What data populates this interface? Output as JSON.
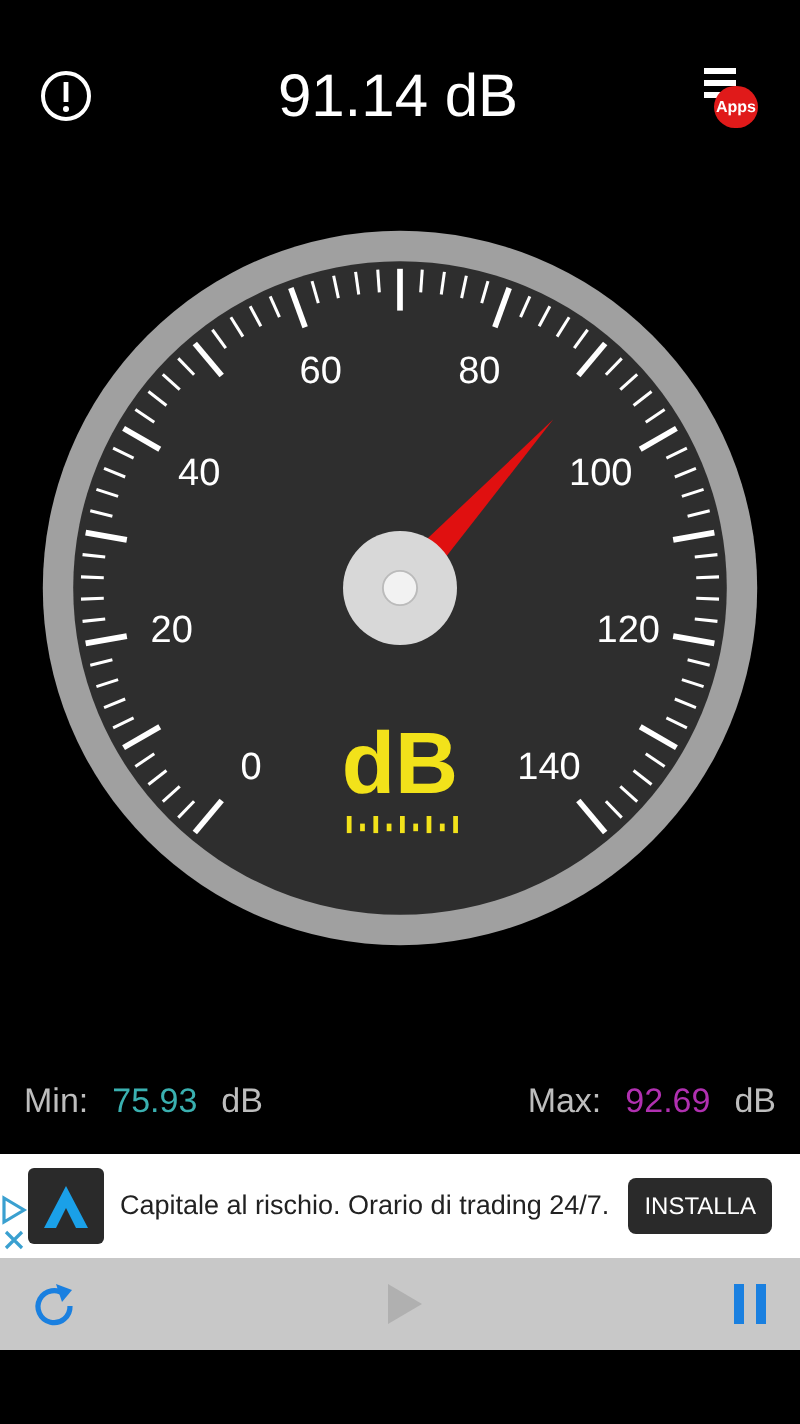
{
  "header": {
    "reading": "91.14 dB",
    "menu_badge": "Apps"
  },
  "gauge": {
    "unit": "dB",
    "scale_labels": [
      "0",
      "20",
      "40",
      "60",
      "80",
      "100",
      "120",
      "140"
    ]
  },
  "stats": {
    "min_label": "Min:",
    "min_value": "75.93",
    "min_unit": "dB",
    "max_label": "Max:",
    "max_value": "92.69",
    "max_unit": "dB"
  },
  "ad": {
    "text": "Capitale al rischio. Orario di trading 24/7.",
    "button": "INSTALLA"
  },
  "controls": {
    "play_disabled": true
  }
}
